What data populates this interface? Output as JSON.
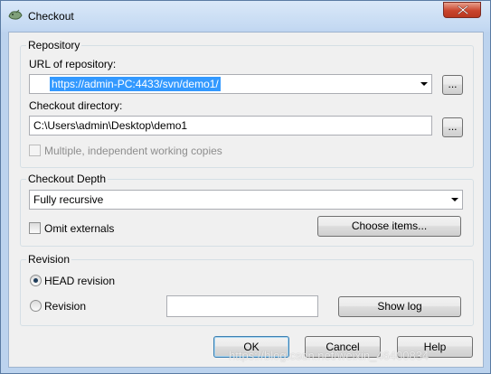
{
  "window": {
    "title": "Checkout"
  },
  "repository_group": {
    "title": "Repository",
    "url_label": "URL of repository:",
    "url_value": "https://admin-PC:4433/svn/demo1/",
    "dir_label": "Checkout directory:",
    "dir_value": "C:\\Users\\admin\\Desktop\\demo1",
    "browse_label": "...",
    "multiple_copies_label": "Multiple, independent working copies"
  },
  "depth_group": {
    "title": "Checkout Depth",
    "depth_value": "Fully recursive",
    "omit_externals_label": "Omit externals",
    "choose_items_label": "Choose items..."
  },
  "revision_group": {
    "title": "Revision",
    "head_label": "HEAD revision",
    "revision_label": "Revision",
    "revision_value": "",
    "show_log_label": "Show log"
  },
  "buttons": {
    "ok": "OK",
    "cancel": "Cancel",
    "help": "Help"
  },
  "watermark": "https://blog.csdn.net/weixin_46400834",
  "colors": {
    "selection": "#3399ff",
    "close_button": "#c9452d"
  }
}
